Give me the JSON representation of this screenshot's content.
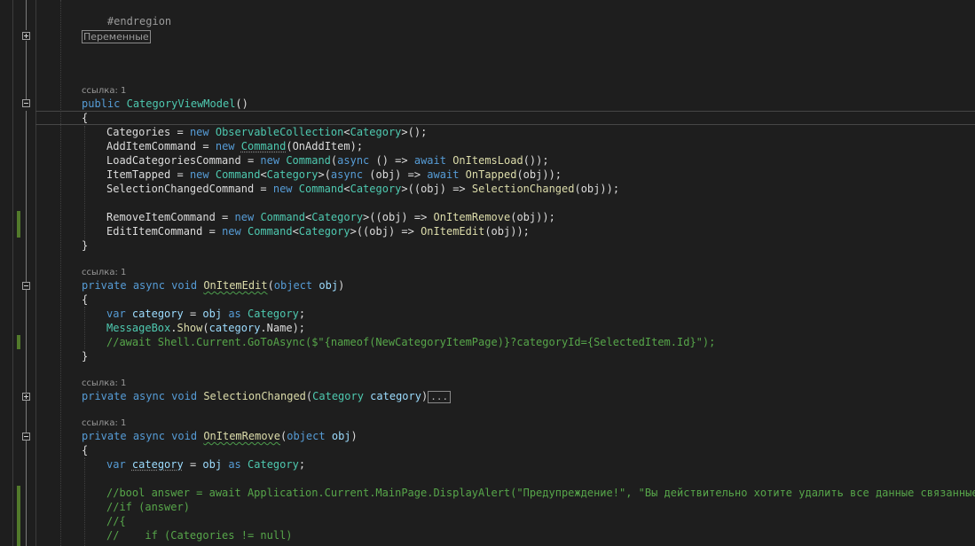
{
  "editor": {
    "region_end": "#endregion",
    "region_collapsed": "Переменные",
    "codelens": [
      "ссылка: 1",
      "ссылка: 1",
      "ссылка: 1",
      "ссылка: 1"
    ],
    "constructor": {
      "signature": [
        "public",
        "CategoryViewModel",
        "()"
      ],
      "open_brace": "{",
      "close_brace": "}",
      "lines": [
        [
          "Categories",
          " = ",
          "new",
          " ",
          "ObservableCollection",
          "<",
          "Category",
          ">();"
        ],
        [
          "AddItemCommand",
          " = ",
          "new",
          " ",
          "Command",
          "(",
          "OnAddItem",
          ");"
        ],
        [
          "LoadCategoriesCommand",
          " = ",
          "new",
          " ",
          "Command",
          "(",
          "async",
          " () => ",
          "await",
          " ",
          "OnItemsLoad",
          "());"
        ],
        [
          "ItemTapped",
          " = ",
          "new",
          " ",
          "Command",
          "<",
          "Category",
          ">(",
          "async",
          " (obj) => ",
          "await",
          " ",
          "OnTapped",
          "(obj));"
        ],
        [
          "SelectionChangedCommand",
          " = ",
          "new",
          " ",
          "Command",
          "<",
          "Category",
          ">((obj) => ",
          "SelectionChanged",
          "(obj));"
        ],
        [
          "RemoveItemCommand",
          " = ",
          "new",
          " ",
          "Command",
          "<",
          "Category",
          ">((obj) => ",
          "OnItemRemove",
          "(obj));"
        ],
        [
          "EditItemCommand",
          " = ",
          "new",
          " ",
          "Command",
          "<",
          "Category",
          ">((obj) => ",
          "OnItemEdit",
          "(obj));"
        ]
      ]
    },
    "on_item_edit": {
      "signature": [
        "private",
        "async",
        "void",
        "OnItemEdit",
        "(",
        "object",
        "obj",
        ")"
      ],
      "line1": [
        "var",
        "category",
        " = ",
        "obj",
        "as",
        "Category",
        ";"
      ],
      "line2": [
        "MessageBox",
        ".",
        "Show",
        "(",
        "category",
        ".",
        "Name",
        ");"
      ],
      "line3": "//await Shell.Current.GoToAsync($\"{nameof(NewCategoryItemPage)}?categoryId={SelectedItem.Id}\");"
    },
    "selection_changed": {
      "signature": [
        "private",
        "async",
        "void",
        "SelectionChanged",
        "(",
        "Category",
        "category",
        ")"
      ],
      "collapsed": "..."
    },
    "on_item_remove": {
      "signature": [
        "private",
        "async",
        "void",
        "OnItemRemove",
        "(",
        "object",
        "obj",
        ")"
      ],
      "line1": [
        "var",
        "category",
        " = ",
        "obj",
        "as",
        "Category",
        ";"
      ],
      "comment1": "//bool answer = await Application.Current.MainPage.DisplayAlert(\"Предупреждение!\", \"Вы действительно хотите удалить все данные связанные с э",
      "comment2": "//if (answer)",
      "comment3": "//{",
      "comment4": "//    if (Categories != null)"
    }
  },
  "colors": {
    "background": "#1e1e1e",
    "keyword": "#569cd6",
    "type": "#4ec9b0",
    "method": "#dcdcaa",
    "comment": "#57a64a",
    "change_bar": "#527a2b"
  }
}
